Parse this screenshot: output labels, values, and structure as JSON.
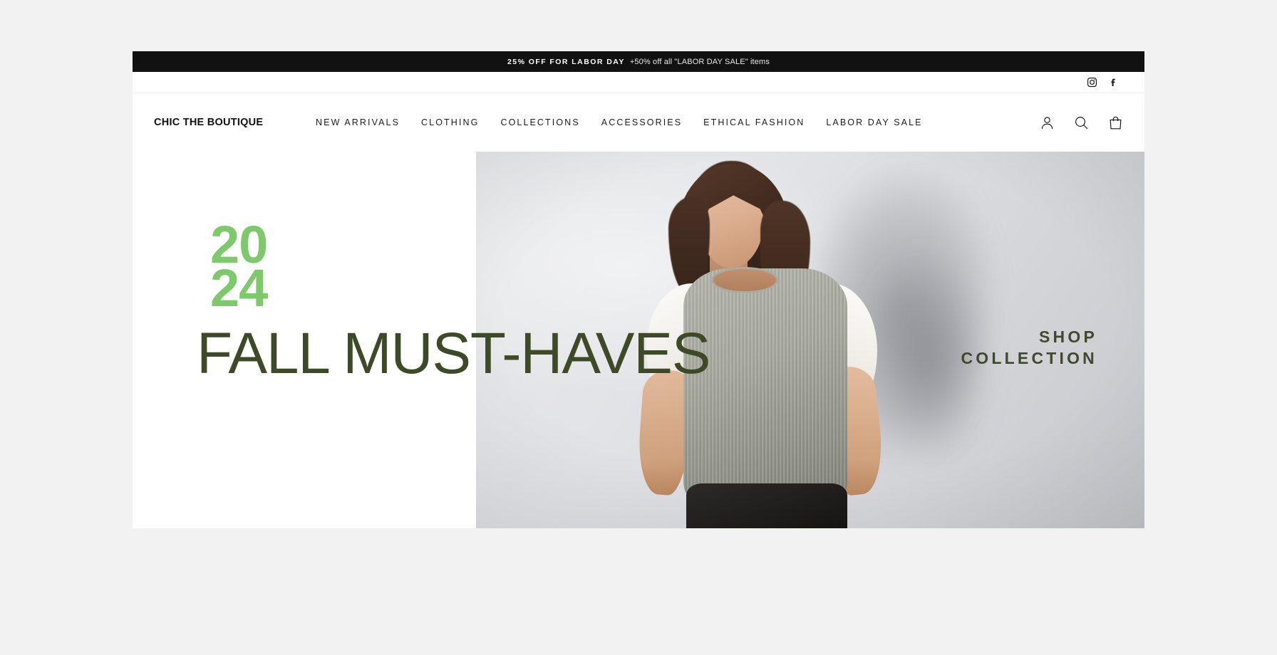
{
  "announcement": {
    "bold_text": "25% OFF FOR LABOR DAY",
    "normal_text": "+50% off all \"LABOR DAY SALE\" items",
    "background_color": "#111111",
    "text_color": "#ffffff"
  },
  "social": {
    "items": [
      {
        "name": "Instagram",
        "icon": "instagram-icon"
      },
      {
        "name": "Facebook",
        "icon": "facebook-icon"
      }
    ]
  },
  "header": {
    "logo": "CHIC THE BOUTIQUE",
    "nav": [
      {
        "label": "NEW ARRIVALS"
      },
      {
        "label": "CLOTHING"
      },
      {
        "label": "COLLECTIONS"
      },
      {
        "label": "ACCESSORIES"
      },
      {
        "label": "ETHICAL FASHION"
      },
      {
        "label": "LABOR DAY SALE"
      }
    ],
    "icons": [
      {
        "name": "account-icon",
        "label": "Log in"
      },
      {
        "name": "search-icon",
        "label": "Search"
      },
      {
        "name": "cart-icon",
        "label": "Cart"
      }
    ]
  },
  "hero": {
    "year_line_1": "20",
    "year_line_2": "24",
    "year_color": "#7dc96b",
    "headline": "FALL MUST-HAVES",
    "headline_color": "#3e4a27",
    "cta_line_1": "SHOP",
    "cta_line_2": "COLLECTION",
    "cta_color": "#3f4a2c",
    "image_alt": "Model wearing a grey knit sweater vest over a white puff-sleeve blouse"
  },
  "theme": {
    "page_background": "#f2f2f2",
    "site_background": "#ffffff",
    "text_color": "#1c1c1c"
  }
}
